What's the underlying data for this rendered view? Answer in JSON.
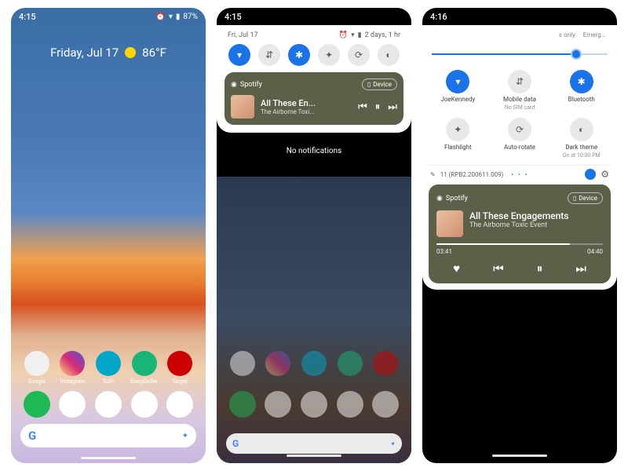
{
  "screen1": {
    "time": "4:15",
    "battery": "87%",
    "date": "Friday, Jul 17",
    "temp": "86°F",
    "apps": [
      {
        "label": "Google",
        "bg": "#f0f0f0"
      },
      {
        "label": "Instagram",
        "bg": "linear-gradient(45deg,#feda75,#d62976,#4f5bd5)"
      },
      {
        "label": "SoFi",
        "bg": "#00a7c8"
      },
      {
        "label": "EveryDollar",
        "bg": "#18b478"
      },
      {
        "label": "Target",
        "bg": "#cc0000"
      }
    ],
    "dock": [
      {
        "name": "spotify",
        "bg": "#1db954"
      },
      {
        "name": "twitter",
        "bg": "#fff"
      },
      {
        "name": "app3",
        "bg": "#fff"
      },
      {
        "name": "app4",
        "bg": "#fff"
      },
      {
        "name": "app5",
        "bg": "#fff"
      }
    ]
  },
  "screen2": {
    "time": "4:15",
    "shade_date": "Fri, Jul 17",
    "shade_right": "2 days, 1 hr",
    "qs": [
      {
        "name": "wifi",
        "on": true
      },
      {
        "name": "mobile-data",
        "on": false
      },
      {
        "name": "bluetooth",
        "on": true
      },
      {
        "name": "flashlight",
        "on": false
      },
      {
        "name": "auto-rotate",
        "on": false
      },
      {
        "name": "dark-theme",
        "on": false
      }
    ],
    "media": {
      "app": "Spotify",
      "device_label": "Device",
      "track": "All These En...",
      "artist": "The Airborne Toxi..."
    },
    "no_notifications": "No notifications"
  },
  "screen3": {
    "time": "4:16",
    "top_right_1": "s only",
    "top_right_2": "Emerg...",
    "qs": [
      {
        "name": "wifi",
        "label": "JoeKennedy",
        "sub": "",
        "on": true
      },
      {
        "name": "mobile-data",
        "label": "Mobile data",
        "sub": "No SIM card",
        "on": false
      },
      {
        "name": "bluetooth",
        "label": "Bluetooth",
        "sub": "",
        "on": true
      },
      {
        "name": "flashlight",
        "label": "Flashlight",
        "sub": "",
        "on": false
      },
      {
        "name": "auto-rotate",
        "label": "Auto-rotate",
        "sub": "",
        "on": false
      },
      {
        "name": "dark-theme",
        "label": "Dark theme",
        "sub": "On at 10:00 PM",
        "on": false
      }
    ],
    "build": "11 (RPB2.200611.009)",
    "media": {
      "app": "Spotify",
      "device_label": "Device",
      "track": "All These Engagements",
      "artist": "The Airborne Toxic Event",
      "elapsed": "03:41",
      "duration": "04:40"
    }
  }
}
